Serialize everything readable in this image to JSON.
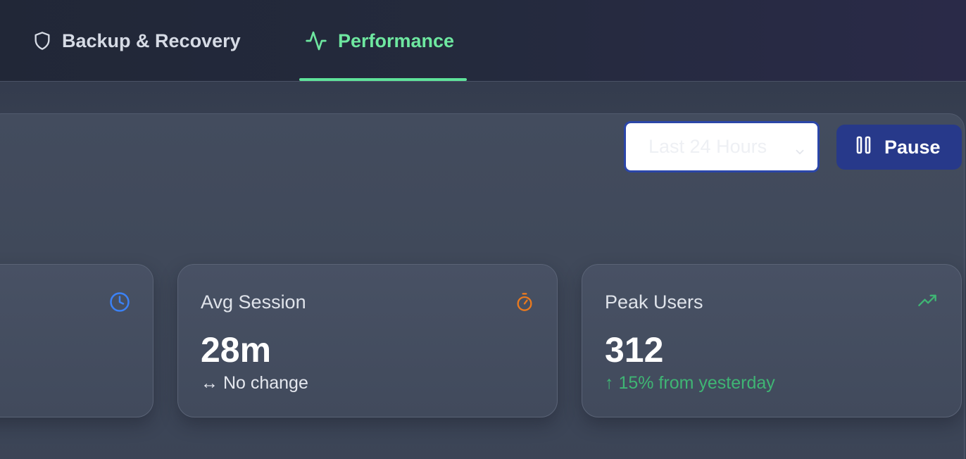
{
  "tabs": [
    {
      "label": "Backup & Recovery",
      "icon": "shield-icon",
      "active": false
    },
    {
      "label": "Performance",
      "icon": "activity-icon",
      "active": true
    }
  ],
  "toolbar": {
    "range_select": {
      "value": "Last 24 Hours"
    },
    "pause_label": "Pause"
  },
  "cards": [
    {
      "label": "",
      "value": "",
      "change": "",
      "icon": "clock-icon",
      "icon_color": "#3b82f6"
    },
    {
      "label": "Avg Session",
      "value": "28m",
      "change": "↔ No change",
      "icon": "timer-icon",
      "icon_color": "#ea7a1e"
    },
    {
      "label": "Peak Users",
      "value": "312",
      "change": "↑ 15% from yesterday",
      "icon": "trending-up-icon",
      "icon_color": "#3fb574"
    }
  ],
  "colors": {
    "accent_active_tab": "#6ee7a0",
    "pause_button": "#27398a",
    "positive": "#3fb574"
  }
}
